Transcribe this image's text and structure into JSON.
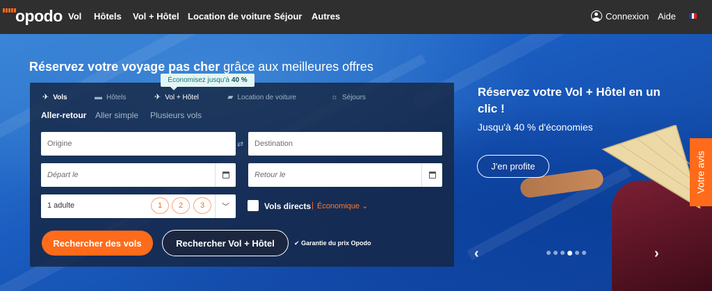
{
  "nav": {
    "logo": "opodo",
    "links": [
      "Vol",
      "Hôtels",
      "Vol + Hôtel",
      "Location de voiture",
      "Séjour",
      "Autres"
    ],
    "login": "Connexion",
    "help": "Aide"
  },
  "hero": {
    "headline_bold": "Réservez votre voyage pas cher",
    "headline_rest": "grâce aux meilleures offres"
  },
  "search": {
    "tabs": [
      "Vols",
      "Hôtels",
      "Vol + Hôtel",
      "Location de voiture",
      "Séjours"
    ],
    "promo": {
      "text": "Économisez jusqu'à",
      "value": "40 %"
    },
    "trip_types": [
      "Aller-retour",
      "Aller simple",
      "Plusieurs vols"
    ],
    "origin_placeholder": "Origine",
    "destination_placeholder": "Destination",
    "depart_placeholder": "Départ le",
    "return_placeholder": "Retour le",
    "passengers": "1 adulte",
    "pax_options": [
      "1",
      "2",
      "3"
    ],
    "direct_label": "Vols directs",
    "cabin": "Économique",
    "search_flights": "Rechercher des vols",
    "search_package": "Rechercher Vol + Hôtel",
    "guarantee": "Garantie du prix Opodo"
  },
  "side_promo": {
    "title": "Réservez votre Vol + Hôtel en un clic !",
    "subtitle": "Jusqu'à 40 % d'économies",
    "cta": "J'en profite",
    "slide_count": 6,
    "active_slide": 4
  },
  "feedback": "Votre avis",
  "colors": {
    "accent": "#ff6b1a",
    "nav_bg": "#2f2f2f",
    "panel_bg": "#162642"
  }
}
